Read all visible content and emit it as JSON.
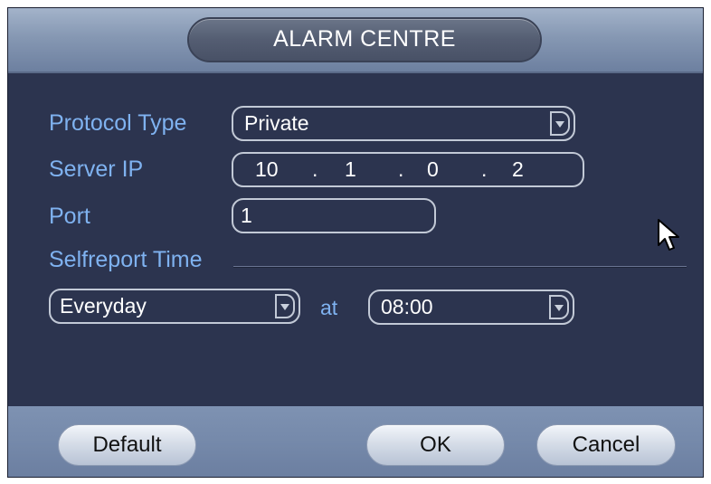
{
  "dialog": {
    "title": "ALARM CENTRE"
  },
  "form": {
    "protocol_type": {
      "label": "Protocol Type",
      "value": "Private"
    },
    "server_ip": {
      "label": "Server IP",
      "octets": [
        "10",
        "1",
        "0",
        "2"
      ],
      "separator": "."
    },
    "port": {
      "label": "Port",
      "value": "1"
    },
    "selfreport": {
      "label": "Selfreport Time",
      "frequency": "Everyday",
      "at_label": "at",
      "time": "08:00"
    }
  },
  "buttons": {
    "default": "Default",
    "ok": "OK",
    "cancel": "Cancel"
  },
  "colors": {
    "panel_bg": "#2c344f",
    "label_text": "#7fb2f0",
    "titlebar": "#8698b3",
    "button_face": "#d6dde8"
  },
  "icons": {
    "dropdown": "chevron-down-icon",
    "pointer": "mouse-cursor-icon"
  }
}
